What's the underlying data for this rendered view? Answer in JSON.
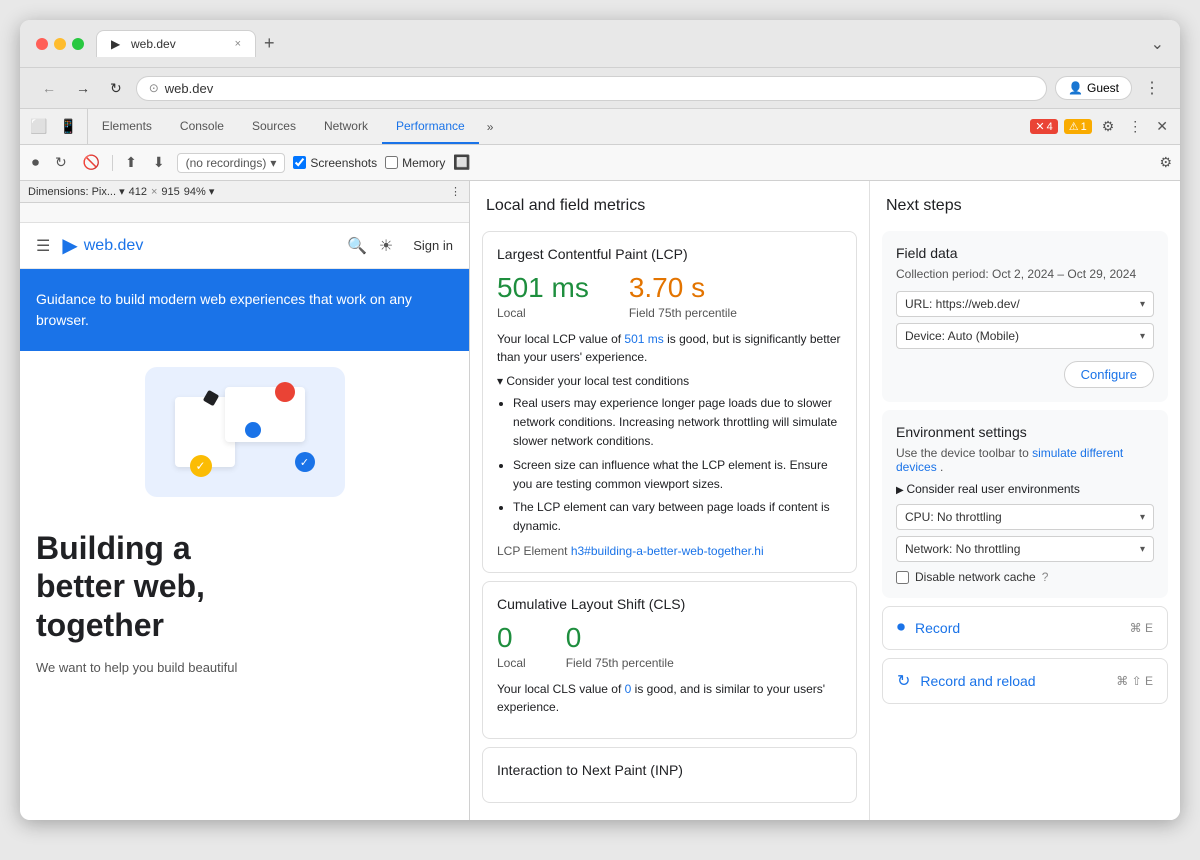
{
  "browser": {
    "title": "web.dev",
    "url": "web.dev",
    "tab_close": "×",
    "new_tab": "+",
    "collapse": "⌄"
  },
  "nav_buttons": {
    "back": "←",
    "forward": "→",
    "refresh": "↻",
    "address_icon": "⊙",
    "menu": "⋮"
  },
  "guest_button": "Guest",
  "dimensions_bar": {
    "label": "Dimensions: Pix...",
    "width": "412",
    "x": "×",
    "height": "915",
    "zoom": "94%"
  },
  "devtools": {
    "tabs": [
      {
        "label": "Elements",
        "active": false
      },
      {
        "label": "Console",
        "active": false
      },
      {
        "label": "Sources",
        "active": false
      },
      {
        "label": "Network",
        "active": false
      },
      {
        "label": "Performance",
        "active": true
      },
      {
        "label": "»",
        "active": false
      }
    ],
    "badges": {
      "red_count": "4",
      "yellow_count": "1"
    }
  },
  "perf_toolbar": {
    "recording_placeholder": "(no recordings)",
    "screenshots_label": "Screenshots",
    "memory_label": "Memory"
  },
  "webpage": {
    "nav": {
      "logo_text": "web.dev",
      "signin": "Sign in"
    },
    "hero_text": "Guidance to build modern web experiences that work on any browser.",
    "heading_line1": "Building a",
    "heading_line2": "better web,",
    "heading_line3": "together",
    "subtext": "We want to help you build beautiful"
  },
  "metrics": {
    "header": "Local and field metrics",
    "lcp": {
      "title": "Largest Contentful Paint (LCP)",
      "local_value": "501 ms",
      "field_value": "3.70 s",
      "local_label": "Local",
      "field_label": "Field 75th percentile",
      "description": "Your local LCP value of 501 ms is good, but is significantly better than your users' experience.",
      "consider_title": "Consider your local test conditions",
      "tips": [
        "Real users may experience longer page loads due to slower network conditions. Increasing network throttling will simulate slower network conditions.",
        "Screen size can influence what the LCP element is. Ensure you are testing common viewport sizes.",
        "The LCP element can vary between page loads if content is dynamic."
      ],
      "element_label": "LCP Element",
      "element_link": "h3#building-a-better-web-together.hi"
    },
    "cls": {
      "title": "Cumulative Layout Shift (CLS)",
      "local_value": "0",
      "field_value": "0",
      "local_label": "Local",
      "field_label": "Field 75th percentile",
      "description": "Your local CLS value of 0 is good, and is similar to your users' experience."
    },
    "inp": {
      "title": "Interaction to Next Paint (INP)"
    }
  },
  "next_steps": {
    "header": "Next steps",
    "field_data": {
      "title": "Field data",
      "collection_period": "Collection period: Oct 2, 2024 – Oct 29, 2024",
      "url_label": "URL: https://web.dev/",
      "device_label": "Device: Auto (Mobile)",
      "configure_btn": "Configure"
    },
    "env_settings": {
      "title": "Environment settings",
      "desc_text": "Use the device toolbar to",
      "desc_link": "simulate different devices",
      "desc_end": ".",
      "consider_label": "Consider real user environments",
      "cpu_label": "CPU: No throttling",
      "network_label": "Network: No throttling",
      "disable_cache": "Disable network cache"
    },
    "record": {
      "label": "Record",
      "shortcut": "⌘ E"
    },
    "record_reload": {
      "label": "Record and reload",
      "shortcut": "⌘ ⇧ E"
    }
  }
}
